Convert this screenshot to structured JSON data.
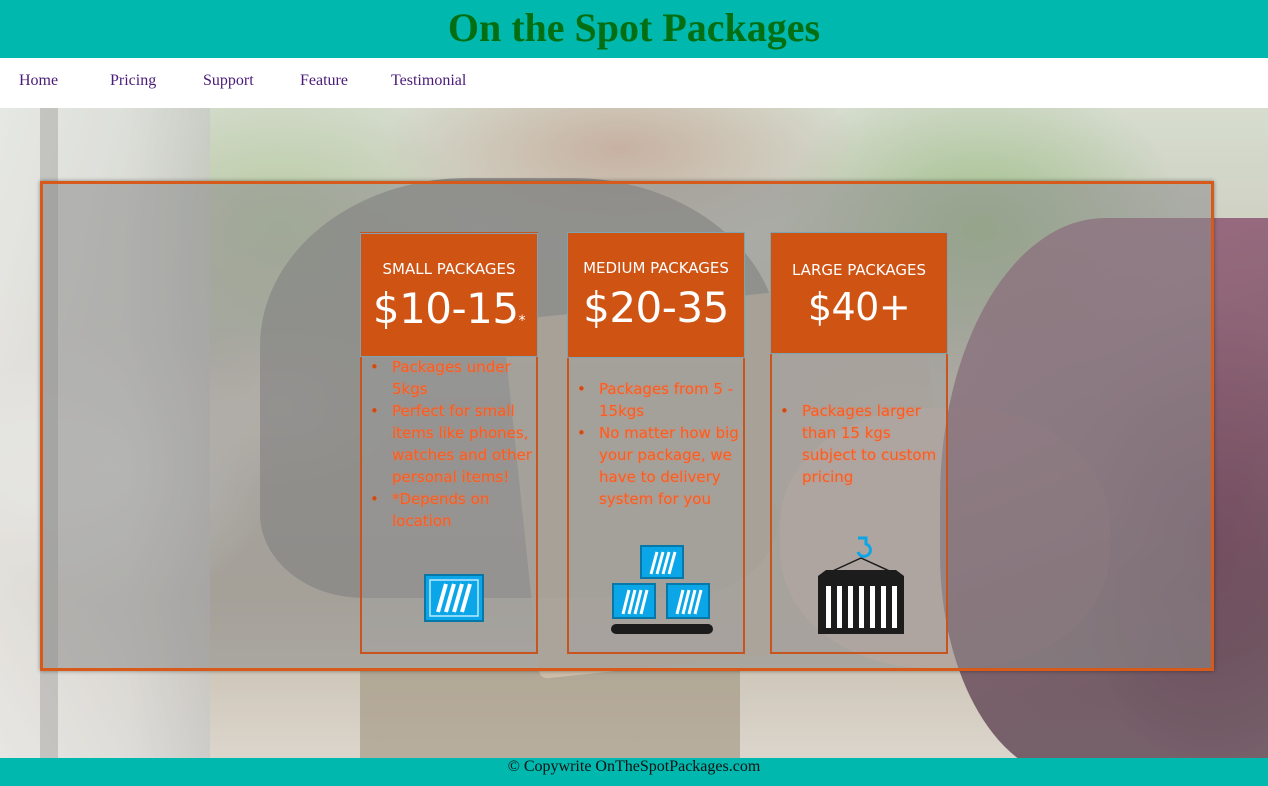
{
  "header": {
    "title": "On the Spot Packages"
  },
  "nav": {
    "items": [
      "Home",
      "Pricing",
      "Support",
      "Feature",
      "Testimonial"
    ]
  },
  "pricing": {
    "cards": [
      {
        "name": "SMALL PACKAGES",
        "price": "$10-15",
        "price_note": "*",
        "features": [
          "Packages under 5kgs",
          "Perfect for small items like phones, watches and other personal items!",
          "*Depends on location"
        ],
        "icon": "single-container-icon"
      },
      {
        "name": "MEDIUM PACKAGES",
        "price": "$20-35",
        "features": [
          "Packages from 5 - 15kgs",
          "No matter how big your package, we have to delivery system for you"
        ],
        "icon": "stacked-containers-icon"
      },
      {
        "name": "LARGE PACKAGES",
        "price": "$40+",
        "features": [
          "Packages larger than 15 kgs subject to custom pricing"
        ],
        "icon": "crane-container-icon"
      }
    ]
  },
  "footer": {
    "text": "© Copywrite OnTheSpotPackages.com"
  },
  "colors": {
    "header_bg": "#00b8ae",
    "title": "#036f12",
    "nav_link": "#4a1a78",
    "card_head": "#cf5313",
    "feature_text": "#ff5a1f",
    "panel_border": "#d75a1a",
    "icon_blue": "#0aa6e8"
  }
}
